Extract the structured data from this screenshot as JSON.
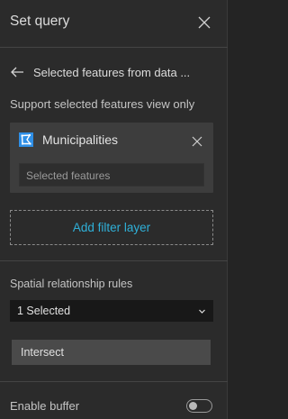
{
  "header": {
    "title": "Set query"
  },
  "back": {
    "label": "Selected features from data ..."
  },
  "support_text": "Support selected features view only",
  "layer": {
    "name": "Municipalities",
    "select_value": "Selected features",
    "icon": "polygon-layer-icon"
  },
  "add_filter": {
    "label": "Add filter layer"
  },
  "rules": {
    "label": "Spatial relationship rules",
    "dropdown_value": "1 Selected",
    "chip": "Intersect"
  },
  "buffer": {
    "label": "Enable buffer",
    "enabled": false
  },
  "colors": {
    "accent": "#2fb0d8",
    "layer_icon": "#2f8fe6",
    "panel_bg": "#2b2b2b"
  }
}
